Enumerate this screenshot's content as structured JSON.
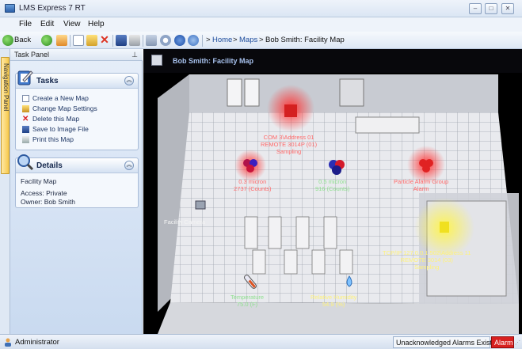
{
  "window": {
    "title": "LMS Express 7 RT"
  },
  "menu": [
    "File",
    "Edit",
    "View",
    "Help"
  ],
  "toolbar": {
    "back_label": "Back",
    "breadcrumb": [
      "Home",
      "Maps",
      "Bob Smith: Facility Map"
    ],
    "crumb_sep": ">"
  },
  "nav_panel": {
    "label": "Navigation Panel"
  },
  "task_panel": {
    "title": "Task Panel",
    "tasks_group": {
      "title": "Tasks",
      "items": [
        "Create a New Map",
        "Change Map Settings",
        "Delete this Map",
        "Save to Image File",
        "Print this Map"
      ]
    },
    "details_group": {
      "title": "Details",
      "name": "Facility Map",
      "access": "Access: Private",
      "owner": "Owner: Bob Smith"
    }
  },
  "map": {
    "title": "Bob Smith: Facility Map",
    "labels": {
      "com3": [
        "COM 3\\Address 01",
        "REMOTE 3014P (01)",
        "Sampling"
      ],
      "p03": [
        "0.3 micron",
        "2737 (Counts)"
      ],
      "p05": [
        "0.5 micron",
        "916 (Counts)"
      ],
      "group": [
        "Particle Alarm Group",
        "Alarm"
      ],
      "camera": [
        "Facility Camera"
      ],
      "tcpip": [
        "TCP/IP 127.0.0.1:502\\Address 11",
        "REMOTE 3014 (03)",
        "Sampling"
      ],
      "temp": [
        "Temperature",
        "75.0 (F)"
      ],
      "humidity": [
        "Relative Humidity",
        "54.9 (%)"
      ]
    }
  },
  "status": {
    "user": "Administrator",
    "alarms_text": "Unacknowledged Alarms Exist",
    "alarm_badge": "Alarm"
  },
  "colors": {
    "alarm": "#d82020",
    "sampling": "#f0e020",
    "normal": "#3fbf3f"
  }
}
